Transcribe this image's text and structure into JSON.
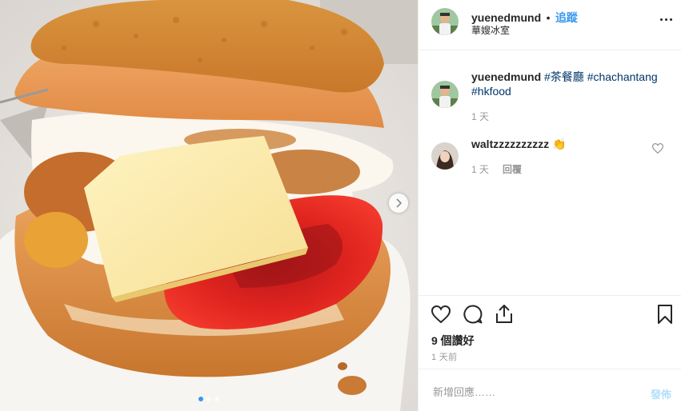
{
  "post": {
    "image_alt": "pineapple bun with fried egg, tomato and cheese"
  },
  "header": {
    "username": "yuenedmund",
    "separator": "•",
    "follow_label": "追蹤",
    "location": "華嫂冰室",
    "more_icon": "more-horizontal-icon"
  },
  "caption": {
    "username": "yuenedmund",
    "hashtags": [
      "#茶餐廳",
      "#chachantang",
      "#hkfood"
    ],
    "time": "1 天"
  },
  "comment": {
    "username": "waltzzzzzzzzzz",
    "emoji": "👏",
    "time": "1 天",
    "reply_label": "回覆"
  },
  "actions": {
    "likes": "9 個讚好",
    "time_ago": "1 天前"
  },
  "add_comment": {
    "placeholder": "新增回應……",
    "post_label": "發佈"
  },
  "carousel": {
    "slides": 3,
    "active_index": 0
  },
  "colors": {
    "accent": "#3897f0",
    "link": "#003569",
    "text": "#262626",
    "muted": "#999999",
    "post_disabled": "#b2dffc"
  }
}
